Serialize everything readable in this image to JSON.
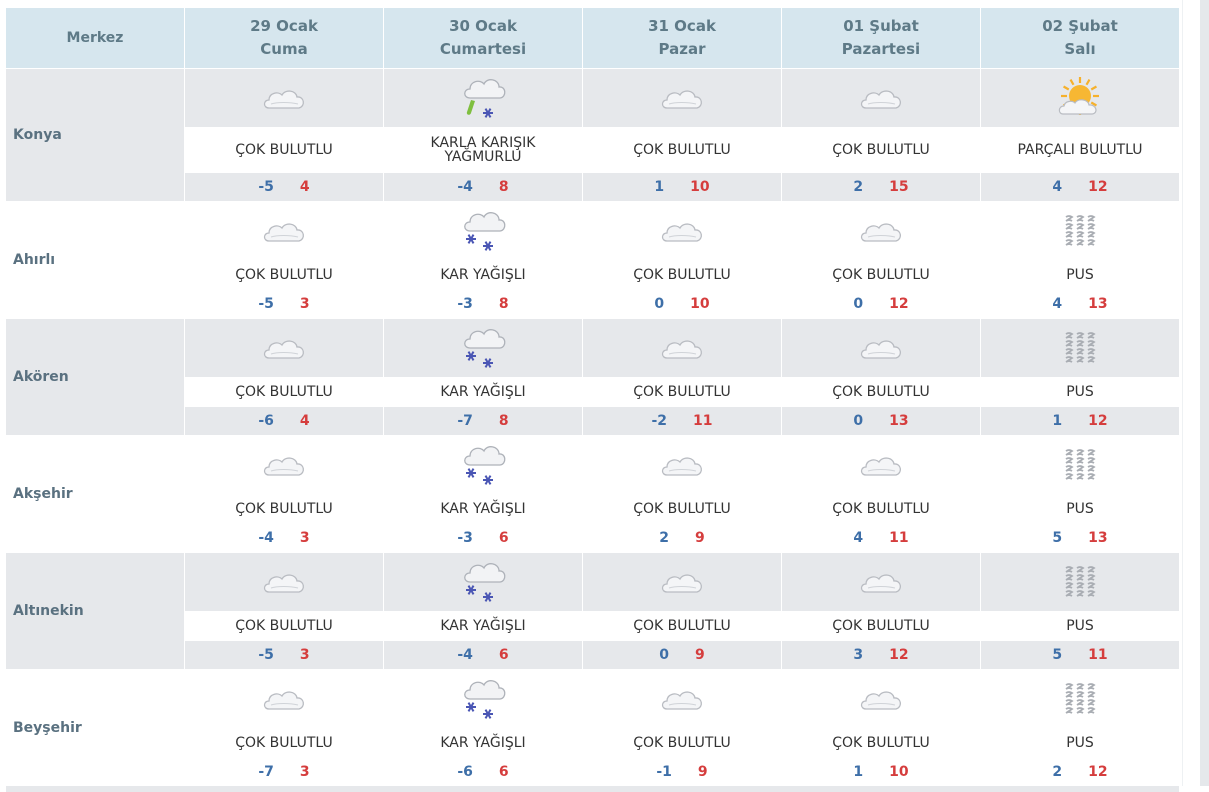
{
  "header": {
    "city_label": "Merkez",
    "days": [
      {
        "date": "29 Ocak",
        "weekday": "Cuma"
      },
      {
        "date": "30 Ocak",
        "weekday": "Cumartesi"
      },
      {
        "date": "31 Ocak",
        "weekday": "Pazar"
      },
      {
        "date": "01 Şubat",
        "weekday": "Pazartesi"
      },
      {
        "date": "02 Şubat",
        "weekday": "Salı"
      }
    ]
  },
  "rows": [
    {
      "city": "Konya",
      "days": [
        {
          "icon": "cloud-icon",
          "condition": "ÇOK BULUTLU",
          "low": "-5",
          "high": "4"
        },
        {
          "icon": "sleet-icon",
          "condition": "KARLA KARIŞIK\nYAĞMURLU",
          "low": "-4",
          "high": "8"
        },
        {
          "icon": "cloud-icon",
          "condition": "ÇOK BULUTLU",
          "low": "1",
          "high": "10"
        },
        {
          "icon": "cloud-icon",
          "condition": "ÇOK BULUTLU",
          "low": "2",
          "high": "15"
        },
        {
          "icon": "partly-sunny-icon",
          "condition": "PARÇALI BULUTLU",
          "low": "4",
          "high": "12"
        }
      ]
    },
    {
      "city": "Ahırlı",
      "days": [
        {
          "icon": "cloud-icon",
          "condition": "ÇOK BULUTLU",
          "low": "-5",
          "high": "3"
        },
        {
          "icon": "snow-icon",
          "condition": "KAR YAĞIŞLI",
          "low": "-3",
          "high": "8"
        },
        {
          "icon": "cloud-icon",
          "condition": "ÇOK BULUTLU",
          "low": "0",
          "high": "10"
        },
        {
          "icon": "cloud-icon",
          "condition": "ÇOK BULUTLU",
          "low": "0",
          "high": "12"
        },
        {
          "icon": "haze-icon",
          "condition": "PUS",
          "low": "4",
          "high": "13"
        }
      ]
    },
    {
      "city": "Akören",
      "days": [
        {
          "icon": "cloud-icon",
          "condition": "ÇOK BULUTLU",
          "low": "-6",
          "high": "4"
        },
        {
          "icon": "snow-icon",
          "condition": "KAR YAĞIŞLI",
          "low": "-7",
          "high": "8"
        },
        {
          "icon": "cloud-icon",
          "condition": "ÇOK BULUTLU",
          "low": "-2",
          "high": "11"
        },
        {
          "icon": "cloud-icon",
          "condition": "ÇOK BULUTLU",
          "low": "0",
          "high": "13"
        },
        {
          "icon": "haze-icon",
          "condition": "PUS",
          "low": "1",
          "high": "12"
        }
      ]
    },
    {
      "city": "Akşehir",
      "days": [
        {
          "icon": "cloud-icon",
          "condition": "ÇOK BULUTLU",
          "low": "-4",
          "high": "3"
        },
        {
          "icon": "snow-icon",
          "condition": "KAR YAĞIŞLI",
          "low": "-3",
          "high": "6"
        },
        {
          "icon": "cloud-icon",
          "condition": "ÇOK BULUTLU",
          "low": "2",
          "high": "9"
        },
        {
          "icon": "cloud-icon",
          "condition": "ÇOK BULUTLU",
          "low": "4",
          "high": "11"
        },
        {
          "icon": "haze-icon",
          "condition": "PUS",
          "low": "5",
          "high": "13"
        }
      ]
    },
    {
      "city": "Altınekin",
      "days": [
        {
          "icon": "cloud-icon",
          "condition": "ÇOK BULUTLU",
          "low": "-5",
          "high": "3"
        },
        {
          "icon": "snow-icon",
          "condition": "KAR YAĞIŞLI",
          "low": "-4",
          "high": "6"
        },
        {
          "icon": "cloud-icon",
          "condition": "ÇOK BULUTLU",
          "low": "0",
          "high": "9"
        },
        {
          "icon": "cloud-icon",
          "condition": "ÇOK BULUTLU",
          "low": "3",
          "high": "12"
        },
        {
          "icon": "haze-icon",
          "condition": "PUS",
          "low": "5",
          "high": "11"
        }
      ]
    },
    {
      "city": "Beyşehir",
      "days": [
        {
          "icon": "cloud-icon",
          "condition": "ÇOK BULUTLU",
          "low": "-7",
          "high": "3"
        },
        {
          "icon": "snow-icon",
          "condition": "KAR YAĞIŞLI",
          "low": "-6",
          "high": "6"
        },
        {
          "icon": "cloud-icon",
          "condition": "ÇOK BULUTLU",
          "low": "-1",
          "high": "9"
        },
        {
          "icon": "cloud-icon",
          "condition": "ÇOK BULUTLU",
          "low": "1",
          "high": "10"
        },
        {
          "icon": "haze-icon",
          "condition": "PUS",
          "low": "2",
          "high": "12"
        }
      ]
    }
  ],
  "colors": {
    "header_bg": "#d6e6ee",
    "header_text": "#5e7a87",
    "shaded_bg": "#e6e8eb",
    "low_temp": "#3e6fa8",
    "high_temp": "#d53d3d",
    "city_text": "#5a7180"
  }
}
